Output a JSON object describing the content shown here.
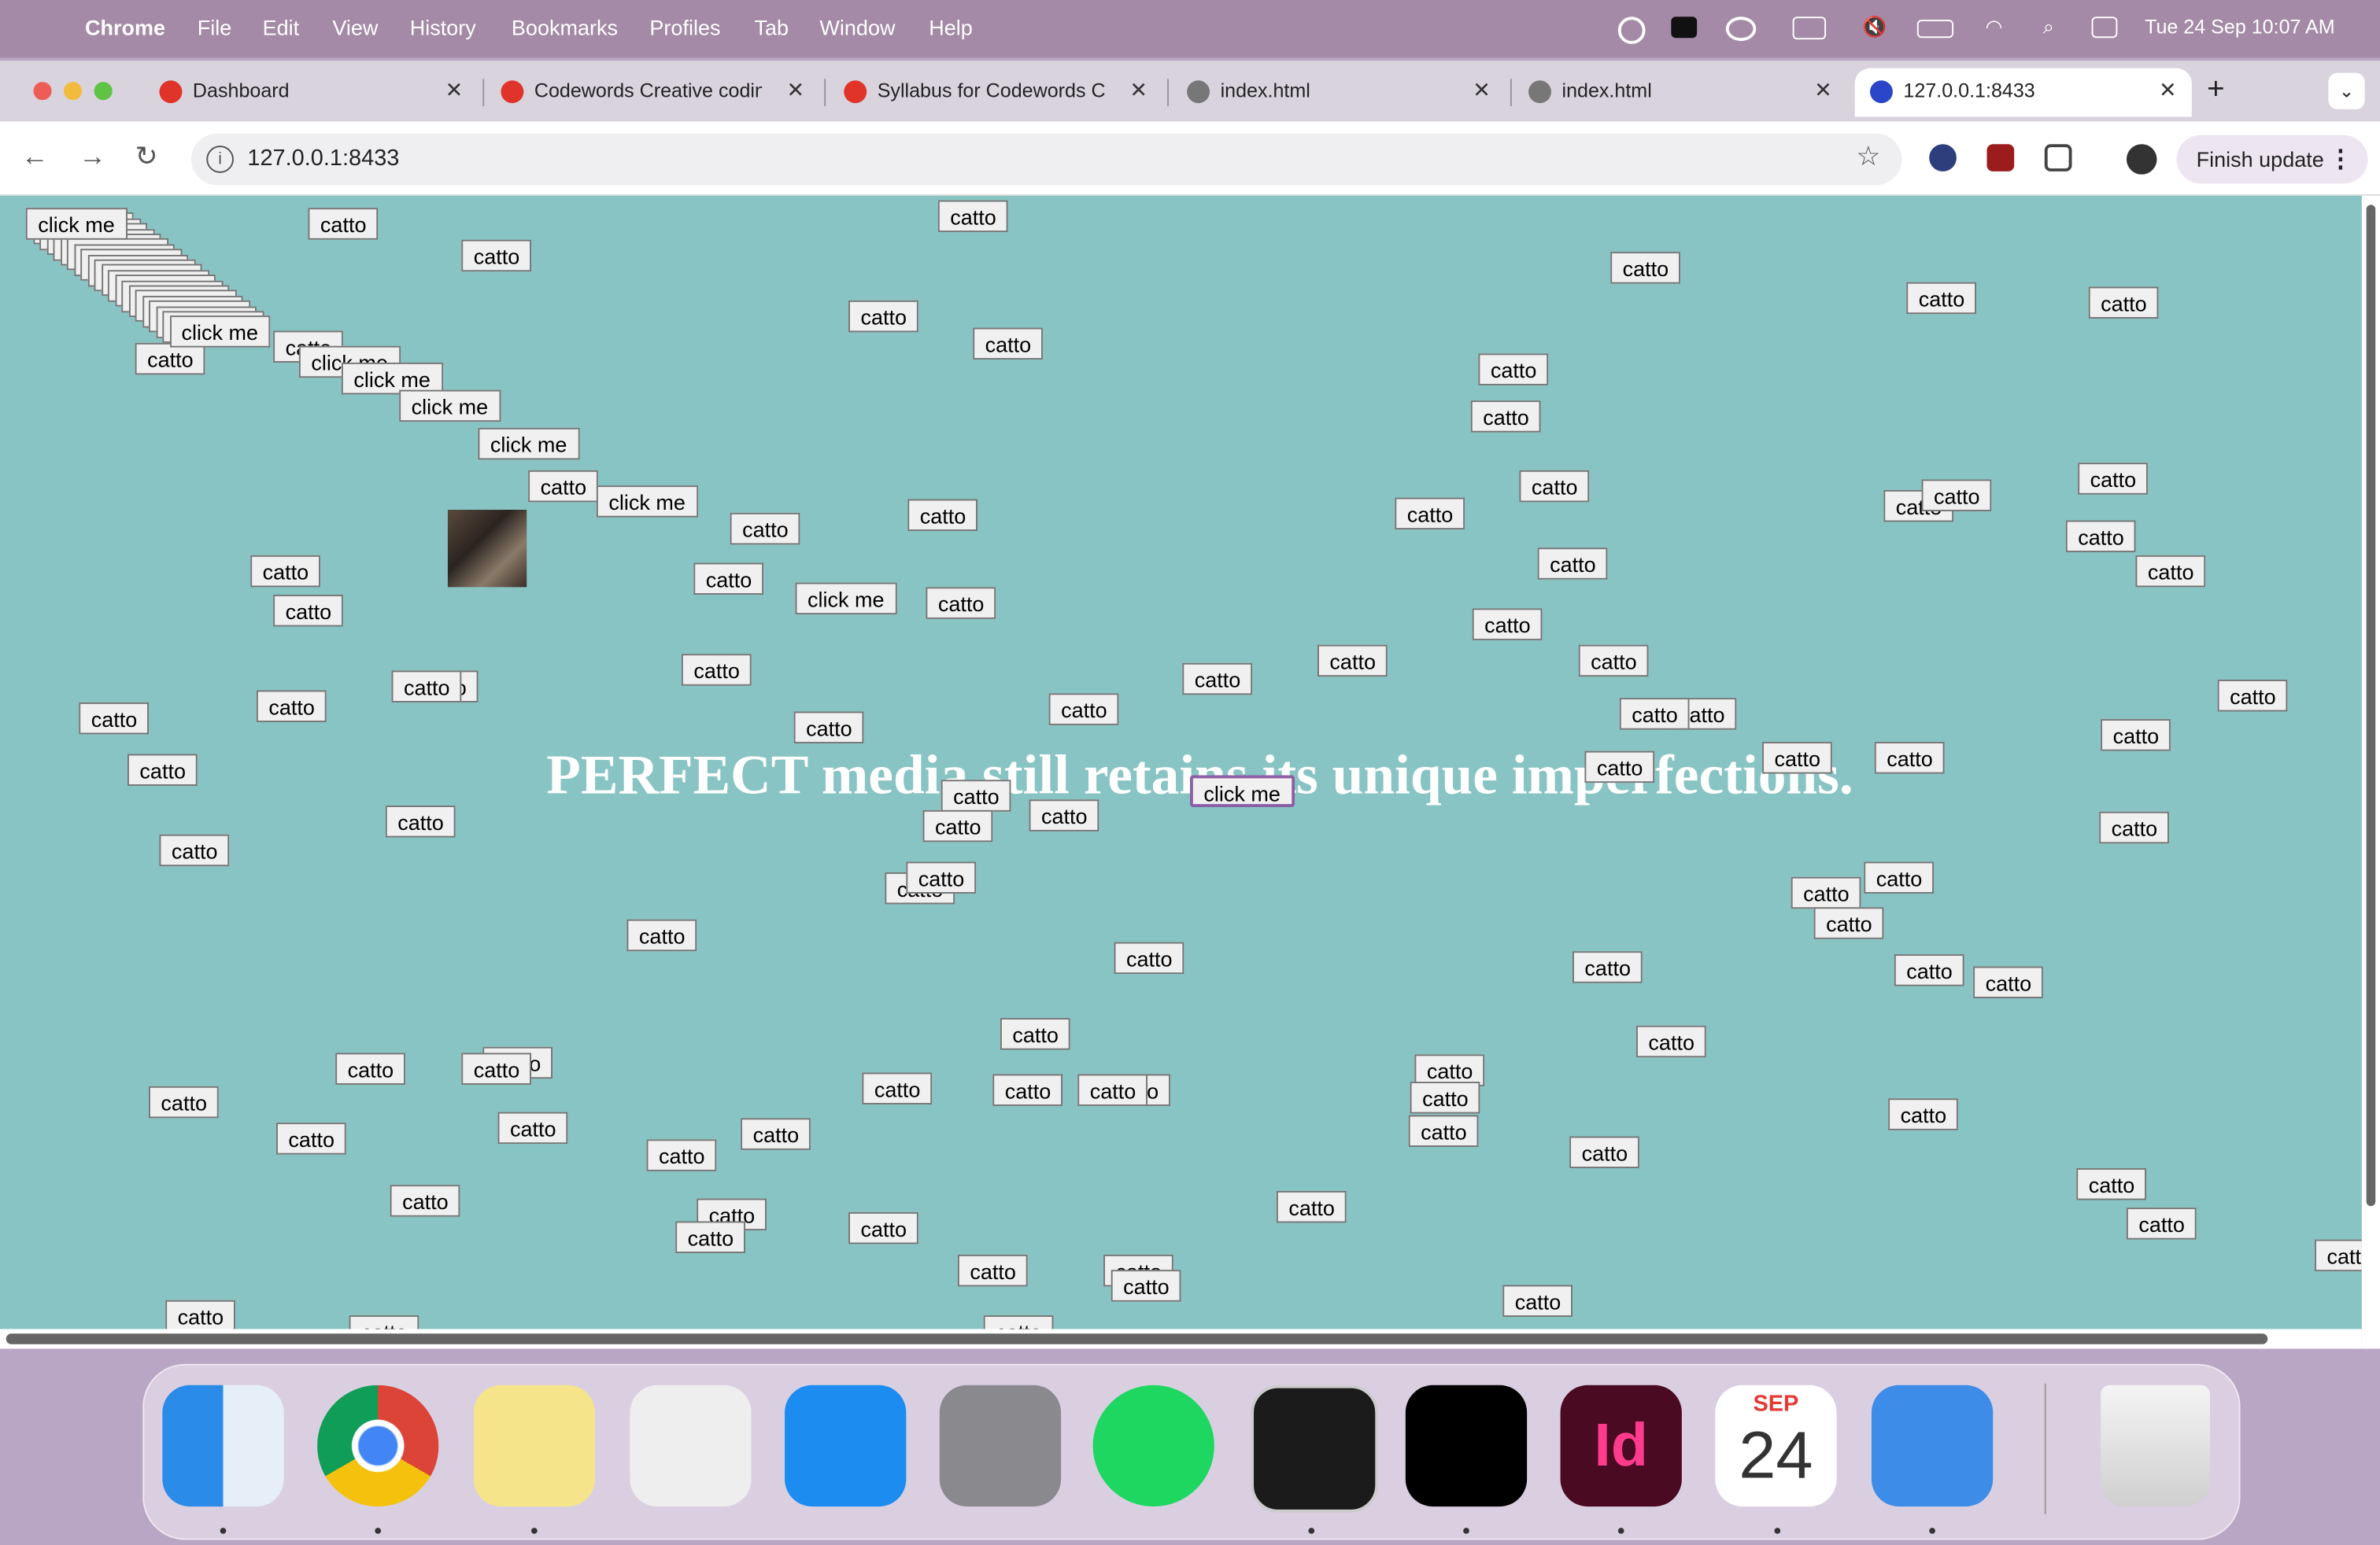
{
  "menubar": {
    "app": "Chrome",
    "items": [
      "File",
      "Edit",
      "View",
      "History",
      "Bookmarks",
      "Profiles",
      "Tab",
      "Window",
      "Help"
    ],
    "datetime": "Tue 24 Sep  10:07 AM"
  },
  "tabs": [
    {
      "title": "Dashboard",
      "close": "✕",
      "favicon_color": "#e0342a"
    },
    {
      "title": "Codewords Creative coding",
      "close": "✕",
      "favicon_color": "#e0342a"
    },
    {
      "title": "Syllabus for Codewords C",
      "close": "✕",
      "favicon_color": "#e0342a"
    },
    {
      "title": "index.html",
      "close": "✕",
      "favicon_color": "#666666"
    },
    {
      "title": "index.html",
      "close": "✕",
      "favicon_color": "#666666"
    },
    {
      "title": "127.0.0.1:8433",
      "close": "✕",
      "favicon_color": "#2b46c8"
    }
  ],
  "newtab": "+",
  "toolbar": {
    "back": "←",
    "forward": "→",
    "reload": "↻",
    "url": "127.0.0.1:8433",
    "star": "☆",
    "finish_update": "Finish update",
    "menu": "⋮"
  },
  "page": {
    "headline": "PERFECT media still retains its unique imperfections.",
    "button_label_catto": "catto",
    "button_label_click": "click me",
    "background": "#89c4c4"
  },
  "dock": {
    "apps": [
      "Finder",
      "Chrome",
      "Stickies",
      "Launchpad",
      "App Store",
      "System Settings",
      "Spotify",
      "Terminal",
      "Logitech G HUB",
      "InDesign",
      "Calendar",
      "Retcon",
      "Trash"
    ],
    "calendar_month": "SEP",
    "calendar_day": "24"
  }
}
